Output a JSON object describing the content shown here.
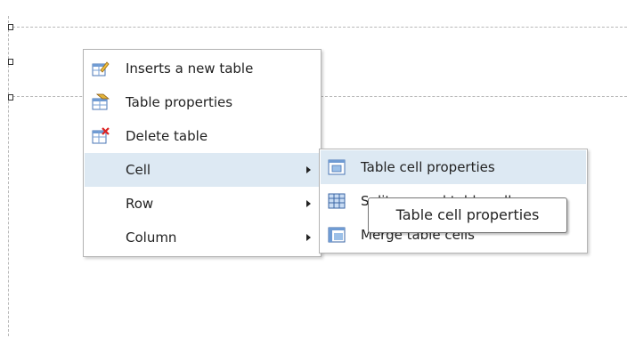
{
  "context_menu": {
    "items": [
      {
        "label": "Inserts a new table",
        "icon": "insert-table-icon"
      },
      {
        "label": "Table properties",
        "icon": "table-properties-icon"
      },
      {
        "label": "Delete table",
        "icon": "delete-table-icon"
      },
      {
        "label": "Cell",
        "has_submenu": true
      },
      {
        "label": "Row",
        "has_submenu": true
      },
      {
        "label": "Column",
        "has_submenu": true
      }
    ]
  },
  "cell_submenu": {
    "items": [
      {
        "label": "Table cell properties",
        "icon": "cell-properties-icon"
      },
      {
        "label": "Split merged table cells",
        "icon": "split-cells-icon"
      },
      {
        "label": "Merge table cells",
        "icon": "merge-cells-icon"
      }
    ]
  },
  "tooltip": {
    "text": "Table cell properties"
  },
  "colors": {
    "highlight": "#dde9f3",
    "border": "#b4b4b4"
  }
}
